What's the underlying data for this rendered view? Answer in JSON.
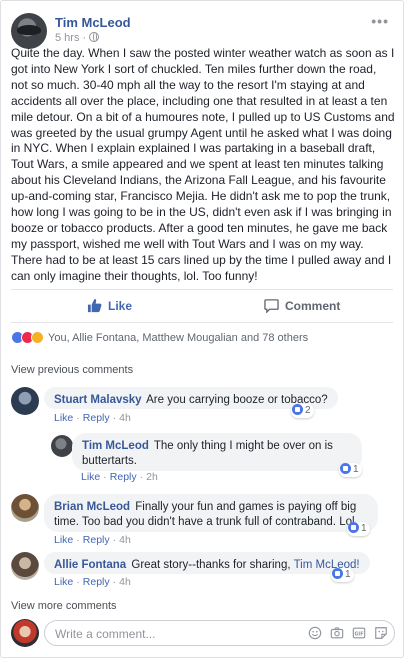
{
  "post": {
    "author": "Tim McLeod",
    "time": "5 hrs",
    "text": "Quite the day. When I saw the posted winter weather watch as soon as I got into New York I sort of chuckled. Ten miles further down the road, not so much. 30-40 mph all the way to the resort I'm staying at and accidents all over the place, including one that resulted in at least a ten mile detour. On a bit of a humoures note, I pulled up to US Customs and was greeted by the usual grumpy Agent until he asked what I was doing in NYC. When I explain explained I was partaking in a baseball draft, Tout Wars, a smile appeared and we spent at least ten minutes talking about his Cleveland Indians, the Arizona Fall League, and his favourite up-and-coming star, Francisco Mejia. He didn't ask me to pop the trunk, how long I was going to be in the US, didn't even ask if I was bringing in booze or tobacco products. After a good ten minutes, he gave me back my passport, wished me well with Tout Wars and I was on my way. There had to be at least 15 cars lined up by the time I pulled away and I can only imagine their thoughts, lol. Too funny!"
  },
  "actions": {
    "like": "Like",
    "comment": "Comment"
  },
  "reactions": {
    "summary": "You, Allie Fontana, Matthew Mougalian and 78 others"
  },
  "view_previous": "View previous comments",
  "comments": [
    {
      "name": "Stuart Malavsky",
      "text": "Are you carrying booze or tobacco?",
      "like": "Like",
      "reply": "Reply",
      "time": "4h",
      "likes": "2"
    },
    {
      "name": "Tim McLeod",
      "text": "The only thing I might be over on is buttertarts.",
      "like": "Like",
      "reply": "Reply",
      "time": "2h",
      "likes": "1"
    },
    {
      "name": "Brian McLeod",
      "text": "Finally your fun and games is paying off big time. Too bad you didn't have a trunk full of contraband. Lol",
      "like": "Like",
      "reply": "Reply",
      "time": "4h",
      "likes": "1"
    },
    {
      "name": "Allie Fontana",
      "text": "Great story--thanks for sharing,",
      "tag": "Tim McLeod!",
      "like": "Like",
      "reply": "Reply",
      "time": "4h",
      "likes": "1"
    }
  ],
  "view_more": "View more comments",
  "composer": {
    "placeholder": "Write a comment..."
  },
  "colors": {
    "link": "#365899",
    "like_blue": "#4267b2",
    "bubble": "#f2f3f5"
  }
}
